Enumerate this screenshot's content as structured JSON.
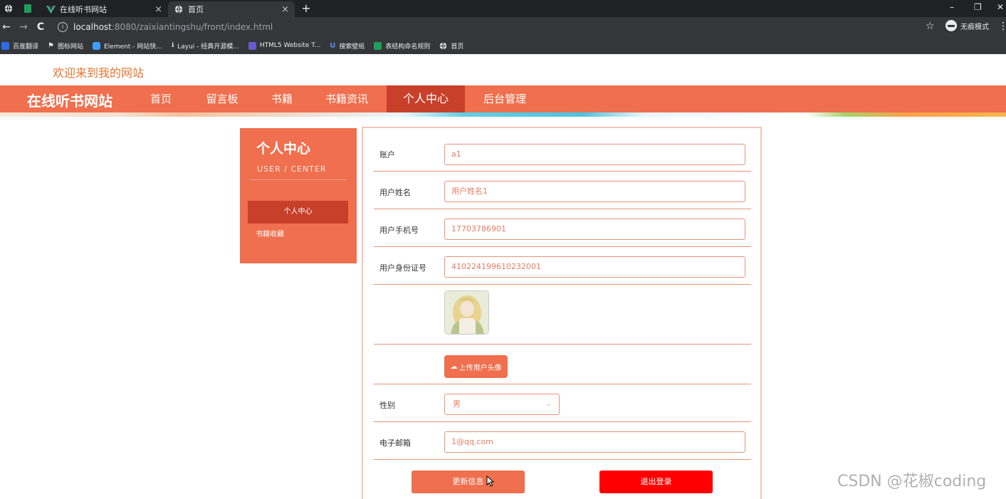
{
  "browser": {
    "tabs": [
      {
        "title": "在线听书网站",
        "close": "×"
      },
      {
        "title": "首页",
        "close": "×"
      }
    ],
    "new_tab": "+",
    "window_controls": {
      "minimize": "–",
      "restore": "❐",
      "close": "✕"
    },
    "nav": {
      "back": "←",
      "forward": "→",
      "reload": "C"
    },
    "url_host": "localhost",
    "url_path": ":8080/zaixiantingshu/front/index.html",
    "incognito_label": "无痕模式",
    "bookmarks": [
      {
        "label": "百度翻译",
        "icon": "baidu-translate-icon",
        "color": "#2b6de8"
      },
      {
        "label": "图标网站",
        "icon": "flag-icon",
        "color": "#e8eaed"
      },
      {
        "label": "Element - 网站快...",
        "icon": "element-icon",
        "color": "#409eff"
      },
      {
        "label": "Layui - 经典开源模...",
        "icon": "layui-icon",
        "color": "#16b777"
      },
      {
        "label": "HTML5 Website T...",
        "icon": "html5-icon",
        "color": "#6a5acd"
      },
      {
        "label": "搜索壁纸",
        "icon": "wallpaper-icon",
        "color": "#5b8def"
      },
      {
        "label": "表结构命名规则",
        "icon": "doc-icon",
        "color": "#1e9e5a"
      },
      {
        "label": "首页",
        "icon": "globe-icon",
        "color": "#e8eaed"
      }
    ]
  },
  "site": {
    "welcome": "欢迎来到我的网站",
    "brand": "在线听书网站",
    "nav": [
      "首页",
      "留言板",
      "书籍",
      "书籍资讯",
      "个人中心",
      "后台管理"
    ],
    "active_nav": "个人中心"
  },
  "sidebar": {
    "title": "个人中心",
    "subtitle": "USER / CENTER",
    "items": [
      "个人中心",
      "书籍收藏"
    ]
  },
  "form": {
    "account": {
      "label": "账户",
      "value": "a1"
    },
    "name": {
      "label": "用户姓名",
      "value": "用户姓名1"
    },
    "phone": {
      "label": "用户手机号",
      "value": "17703786901"
    },
    "idcard": {
      "label": "用户身份证号",
      "value": "410224199610232001"
    },
    "upload_label": "上传用户头像",
    "gender": {
      "label": "性别",
      "value": "男"
    },
    "email": {
      "label": "电子邮箱",
      "value": "1@qq.com"
    },
    "update_button": "更新信息",
    "logout_button": "退出登录"
  },
  "watermark": "CSDN @花椒coding",
  "colors": {
    "accent": "#ef6f4e",
    "accent_dark": "#c9402a",
    "danger": "#ff0000",
    "welcome": "#e3752f"
  }
}
